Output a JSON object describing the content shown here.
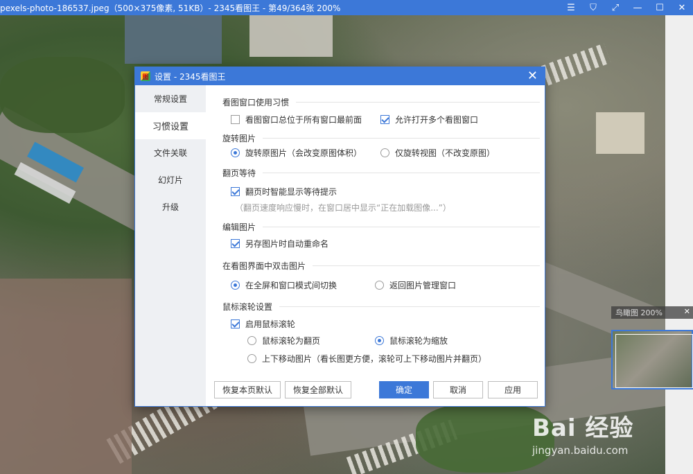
{
  "viewer": {
    "title": "pexels-photo-186537.jpeg（500×375像素, 51KB）- 2345看图王 - 第49/364张 200%",
    "controls": [
      "menu-icon",
      "skin-icon",
      "fullscreen-icon",
      "minimize-icon",
      "maximize-icon",
      "close-icon"
    ],
    "ctrl_glyphs": [
      "☰",
      "⛉",
      "⤢",
      "—",
      "☐",
      "✕"
    ]
  },
  "birdseye": {
    "label": "鸟瞰图 200%",
    "close": "✕"
  },
  "watermark": {
    "brand": "Bai 经验",
    "url": "jingyan.baidu.com"
  },
  "dialog": {
    "title": "设置 - 2345看图王",
    "icon_text": "图",
    "close": "✕",
    "nav": [
      {
        "label": "常规设置",
        "active": false
      },
      {
        "label": "习惯设置",
        "active": true
      },
      {
        "label": "文件关联",
        "active": false
      },
      {
        "label": "幻灯片",
        "active": false
      },
      {
        "label": "升级",
        "active": false
      }
    ],
    "sections": {
      "window": {
        "title": "看图窗口使用习惯",
        "topmost": {
          "label": "看图窗口总位于所有窗口最前面",
          "checked": false
        },
        "multi": {
          "label": "允许打开多个看图窗口",
          "checked": true
        }
      },
      "rotate": {
        "title": "旋转图片",
        "original": {
          "label": "旋转原图片（会改变原图体积）",
          "selected": true
        },
        "view_only": {
          "label": "仅旋转视图（不改变原图）",
          "selected": false
        }
      },
      "wait": {
        "title": "翻页等待",
        "smart": {
          "label": "翻页时智能显示等待提示",
          "checked": true
        },
        "hint": "（翻页速度响应慢时，在窗口居中显示“正在加载图像...”）"
      },
      "edit": {
        "title": "编辑图片",
        "rename": {
          "label": "另存图片时自动重命名",
          "checked": true
        }
      },
      "dblclick": {
        "title": "在看图界面中双击图片",
        "toggle": {
          "label": "在全屏和窗口模式间切换",
          "selected": true
        },
        "back": {
          "label": "返回图片管理窗口",
          "selected": false
        }
      },
      "wheel": {
        "title": "鼠标滚轮设置",
        "enable": {
          "label": "启用鼠标滚轮",
          "checked": true
        },
        "page": {
          "label": "鼠标滚轮为翻页",
          "selected": false
        },
        "zoom": {
          "label": "鼠标滚轮为缩放",
          "selected": true
        },
        "move": {
          "label": "上下移动图片（看长图更方便，滚轮可上下移动图片并翻页）",
          "selected": false
        }
      }
    },
    "buttons": {
      "restore_page": "恢复本页默认",
      "restore_all": "恢复全部默认",
      "ok": "确定",
      "cancel": "取消",
      "apply": "应用"
    }
  },
  "colors": {
    "accent": "#3c78d8"
  }
}
